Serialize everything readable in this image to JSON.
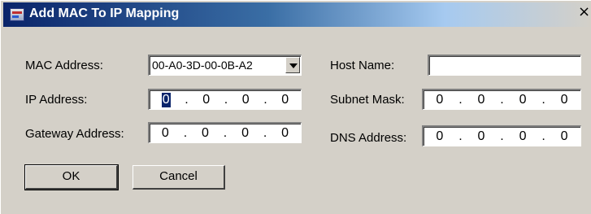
{
  "window": {
    "title": "Add MAC To IP Mapping",
    "close_glyph": "×"
  },
  "form": {
    "mac_label": "MAC Address:",
    "mac_value": "00-A0-3D-00-0B-A2",
    "ip_label": "IP Address:",
    "ip_octets": [
      "0",
      "0",
      "0",
      "0"
    ],
    "gateway_label": "Gateway Address:",
    "gateway_octets": [
      "0",
      "0",
      "0",
      "0"
    ],
    "host_label": "Host Name:",
    "host_value": "",
    "subnet_label": "Subnet Mask:",
    "subnet_octets": [
      "0",
      "0",
      "0",
      "0"
    ],
    "dns_label": "DNS Address:",
    "dns_octets": [
      "0",
      "0",
      "0",
      "0"
    ],
    "ip_separator": "."
  },
  "buttons": {
    "ok_label": "OK",
    "cancel_label": "Cancel"
  },
  "colors": {
    "titlebar_start": "#0a246a",
    "titlebar_end": "#d4d0c8",
    "dialog_bg": "#d4d0c8"
  }
}
